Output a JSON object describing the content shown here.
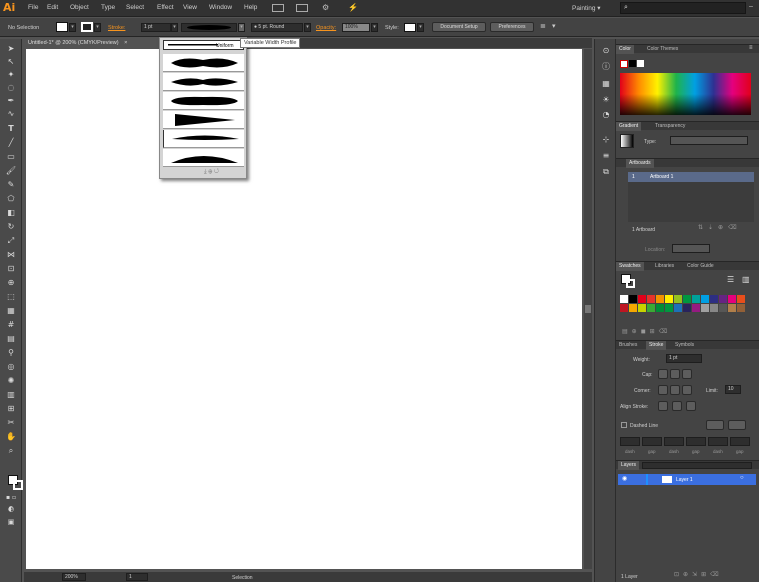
{
  "app": {
    "logo": "Ai"
  },
  "menu": [
    "File",
    "Edit",
    "Object",
    "Type",
    "Select",
    "Effect",
    "View",
    "Window",
    "Help"
  ],
  "workspace": "Painting",
  "search": {
    "value": ""
  },
  "control": {
    "selection": "No Selection",
    "stroke_label": "Stroke:",
    "stroke_value": "1 pt",
    "brush_value": "5 pt. Round",
    "opacity_label": "Opacity:",
    "opacity_value": "100%",
    "style_label": "Style:",
    "document_setup": "Document Setup",
    "preferences": "Preferences"
  },
  "document": {
    "tab": "Untitled-1* @ 200% (CMYK/Preview)"
  },
  "width_profile": {
    "tooltip": "Variable Width Profile",
    "selected": "Uniform"
  },
  "panels": {
    "color": {
      "tabs": [
        "Color",
        "Color Themes"
      ]
    },
    "gradient": {
      "tabs": [
        "Gradient",
        "Transparency"
      ],
      "type_label": "Type:"
    },
    "artboards": {
      "tab": "Artboards",
      "rows": [
        {
          "num": "1",
          "name": "Artboard 1"
        }
      ],
      "footer": "1 Artboard",
      "location_label": "Location:"
    },
    "swatches": {
      "tabs": [
        "Swatches",
        "Libraries",
        "Color Guide"
      ]
    },
    "stroke": {
      "tabs": [
        "Brushes",
        "Stroke",
        "Symbols"
      ],
      "weight_label": "Weight:",
      "weight_value": "1 pt",
      "cap_label": "Cap:",
      "corner_label": "Corner:",
      "limit_label": "Limit:",
      "limit_value": "10",
      "align_label": "Align Stroke:",
      "dashed_label": "Dashed Line",
      "dash_labels": [
        "dash",
        "gap",
        "dash",
        "gap",
        "dash",
        "gap"
      ]
    },
    "layers": {
      "tab": "Layers",
      "rows": [
        {
          "name": "Layer 1"
        }
      ],
      "footer": "1 Layer"
    }
  },
  "status": {
    "zoom": "200%",
    "artboard": "1",
    "tool": "Selection"
  },
  "colors": {
    "accent": "#f7941e",
    "selection": "#3b6fe0"
  }
}
